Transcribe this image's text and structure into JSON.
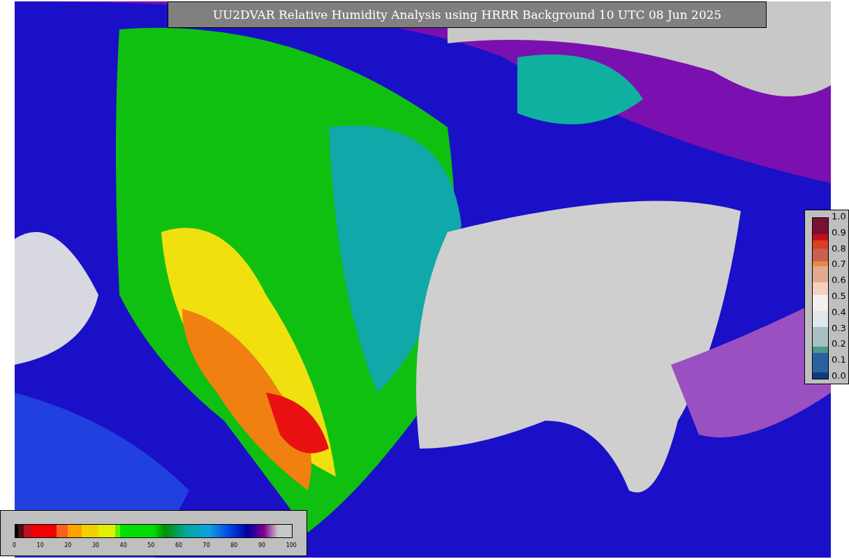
{
  "title": "UU2DVAR Relative Humidity Analysis using HRRR Background 10 UTC 08 Jun 2025",
  "humidity_colorbar": {
    "ticks": [
      "0",
      "10",
      "20",
      "30",
      "40",
      "50",
      "60",
      "70",
      "80",
      "90",
      "100"
    ]
  },
  "observation_colorbar": {
    "ticks": [
      "1.0",
      "0.9",
      "0.8",
      "0.7",
      "0.6",
      "0.5",
      "0.4",
      "0.3",
      "0.2",
      "0.1",
      "0.0"
    ]
  }
}
